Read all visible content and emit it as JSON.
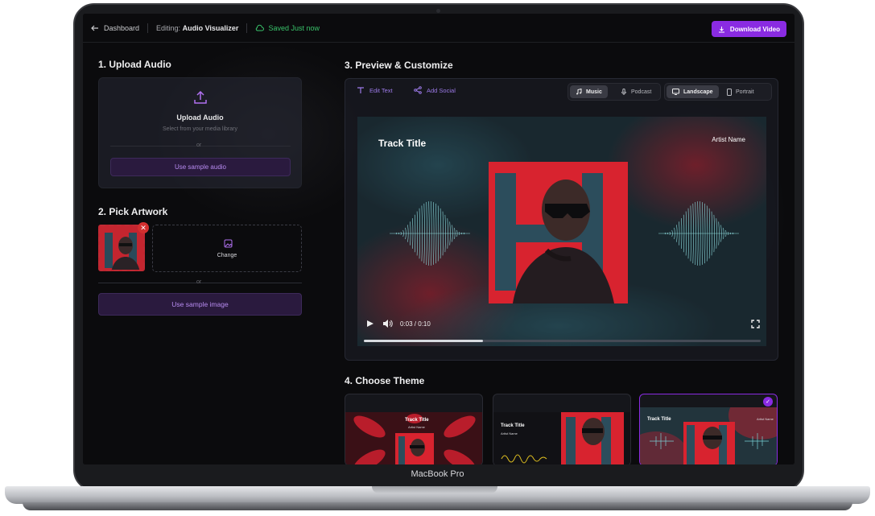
{
  "header": {
    "back_label": "Dashboard",
    "editing_prefix": "Editing:",
    "project_name": "Audio Visualizer",
    "saved_status": "Saved Just now",
    "download_label": "Download Video"
  },
  "sections": {
    "upload_heading": "1. Upload Audio",
    "artwork_heading": "2. Pick Artwork",
    "preview_heading": "3. Preview & Customize",
    "theme_heading": "4. Choose Theme"
  },
  "upload": {
    "title": "Upload Audio",
    "subtitle": "Select from your media library",
    "or": "or",
    "sample_label": "Use sample audio"
  },
  "artwork": {
    "change_label": "Change",
    "or": "or",
    "sample_label": "Use sample image",
    "remove_glyph": "✕"
  },
  "toolbar": {
    "edit_text": "Edit Text",
    "add_social": "Add Social",
    "mode_options": [
      "Music",
      "Podcast"
    ],
    "mode_selected": "Music",
    "orientation_options": [
      "Landscape",
      "Portrait"
    ],
    "orientation_selected": "Landscape"
  },
  "preview": {
    "track_title": "Track Title",
    "artist_name": "Artist Name",
    "time": "0:03 / 0:10",
    "progress": 0.3
  },
  "themes": [
    {
      "title": "Track Title",
      "sub": "Artist Name",
      "selected": false
    },
    {
      "title": "Track Title",
      "sub": "Artist Name",
      "selected": false
    },
    {
      "title": "Track Title",
      "sub": "Artist Name",
      "selected": true
    }
  ],
  "device": {
    "label": "MacBook Pro"
  },
  "colors": {
    "accent": "#8a2be2",
    "saved": "#39c26a",
    "artwork_red": "#d8232f"
  }
}
